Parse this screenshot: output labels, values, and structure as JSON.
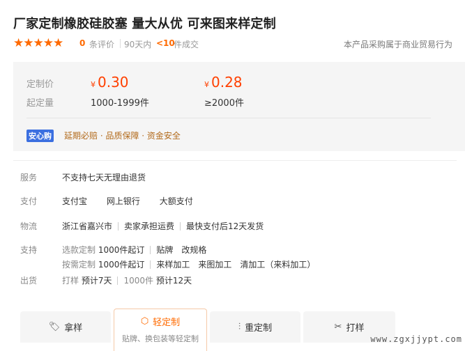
{
  "title": "厂家定制橡胶硅胶塞 量大从优 可来图来样定制",
  "rating": {
    "stars": 5,
    "review_count": "0",
    "review_label": "条评价",
    "sales_prefix": "90天内",
    "sales_count": "<10",
    "sales_label": "件成交",
    "note": "本产品采购属于商业贸易行为"
  },
  "pricing": {
    "price_label": "定制价",
    "qty_label": "起定量",
    "currency": "¥",
    "tiers": [
      {
        "price": "0.30",
        "qty": "1000-1999件"
      },
      {
        "price": "0.28",
        "qty": "≥2000件"
      }
    ]
  },
  "assurance": {
    "badge": "安心购",
    "text": "延期必赔 · 品质保障 · 资金安全"
  },
  "services": {
    "service_label": "服务",
    "service_value": "不支持七天无理由退货",
    "payment_label": "支付",
    "payment_methods": [
      "支付宝",
      "网上银行",
      "大额支付"
    ],
    "logistics_label": "物流",
    "logistics": [
      "浙江省嘉兴市",
      "卖家承担运费",
      "最快支付后12天发货"
    ],
    "support_label": "支持",
    "support_row1": {
      "name": "选款定制",
      "moq": "1000件起订",
      "items": [
        "贴牌",
        "改规格"
      ]
    },
    "support_row2": {
      "name": "按需定制",
      "moq": "1000件起订",
      "items": [
        "来样加工",
        "来图加工",
        "清加工（来料加工）"
      ]
    },
    "shipping_label": "出货",
    "shipping": {
      "a_name": "打样",
      "a_time": "预计7天",
      "b_name": "1000件",
      "b_time": "预计12天"
    }
  },
  "tabs": [
    {
      "label": "拿样",
      "icon": "sample-icon"
    },
    {
      "label": "轻定制",
      "sub": "贴牌、换包装等轻定制",
      "icon": "box-icon"
    },
    {
      "label": "重定制",
      "icon": "sliders-icon"
    },
    {
      "label": "打样",
      "icon": "tools-icon"
    }
  ],
  "watermark": "www.zgxjjypt.com",
  "colors": {
    "accent": "#ff6a00",
    "price": "#ff4000",
    "badge": "#3b6fe0"
  }
}
